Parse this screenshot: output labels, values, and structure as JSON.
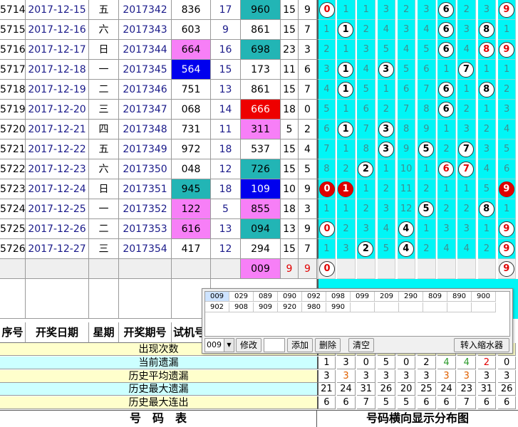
{
  "colors": {
    "accent_cyan": "#00f6f6",
    "teal": "#22b5b5",
    "pink": "#f77ff7",
    "blue": "#0000ee",
    "red": "#ee0000",
    "yellow": "#ffffcc",
    "light_cyan": "#ccffff"
  },
  "rows": [
    {
      "seq": "5714",
      "date": "2017-12-15",
      "week": "五",
      "period": "2017342",
      "trial": "836",
      "trial_bg": "",
      "sum1": "17",
      "draw": "960",
      "draw_bg": "teal",
      "sum2": "15",
      "span": "9",
      "cells": [
        {
          "v": "0",
          "s": "red-text"
        },
        {
          "v": "1",
          "s": ""
        },
        {
          "v": "1",
          "s": ""
        },
        {
          "v": "3",
          "s": ""
        },
        {
          "v": "2",
          "s": ""
        },
        {
          "v": "3",
          "s": ""
        },
        {
          "v": "6",
          "s": "ball"
        },
        {
          "v": "2",
          "s": ""
        },
        {
          "v": "3",
          "s": ""
        },
        {
          "v": "9",
          "s": "red-text"
        }
      ]
    },
    {
      "seq": "5715",
      "date": "2017-12-16",
      "week": "六",
      "period": "2017343",
      "trial": "603",
      "trial_bg": "",
      "sum1": "9",
      "draw": "861",
      "draw_bg": "",
      "sum2": "15",
      "span": "7",
      "cells": [
        {
          "v": "1",
          "s": ""
        },
        {
          "v": "1",
          "s": "ball"
        },
        {
          "v": "2",
          "s": ""
        },
        {
          "v": "4",
          "s": ""
        },
        {
          "v": "3",
          "s": ""
        },
        {
          "v": "4",
          "s": ""
        },
        {
          "v": "6",
          "s": "ball"
        },
        {
          "v": "3",
          "s": ""
        },
        {
          "v": "8",
          "s": "ball"
        },
        {
          "v": "1",
          "s": ""
        }
      ]
    },
    {
      "seq": "5716",
      "date": "2017-12-17",
      "week": "日",
      "period": "2017344",
      "trial": "664",
      "trial_bg": "pink",
      "sum1": "16",
      "draw": "698",
      "draw_bg": "teal",
      "sum2": "23",
      "span": "3",
      "cells": [
        {
          "v": "2",
          "s": ""
        },
        {
          "v": "1",
          "s": ""
        },
        {
          "v": "3",
          "s": ""
        },
        {
          "v": "5",
          "s": ""
        },
        {
          "v": "4",
          "s": ""
        },
        {
          "v": "5",
          "s": ""
        },
        {
          "v": "6",
          "s": "ball"
        },
        {
          "v": "4",
          "s": ""
        },
        {
          "v": "8",
          "s": "red-text"
        },
        {
          "v": "9",
          "s": "red-text"
        }
      ]
    },
    {
      "seq": "5717",
      "date": "2017-12-18",
      "week": "一",
      "period": "2017345",
      "trial": "564",
      "trial_bg": "blue",
      "sum1": "15",
      "draw": "173",
      "draw_bg": "",
      "sum2": "11",
      "span": "6",
      "cells": [
        {
          "v": "3",
          "s": ""
        },
        {
          "v": "1",
          "s": "ball"
        },
        {
          "v": "4",
          "s": ""
        },
        {
          "v": "3",
          "s": "ball"
        },
        {
          "v": "5",
          "s": ""
        },
        {
          "v": "6",
          "s": ""
        },
        {
          "v": "1",
          "s": ""
        },
        {
          "v": "7",
          "s": "ball"
        },
        {
          "v": "1",
          "s": ""
        },
        {
          "v": "1",
          "s": ""
        }
      ]
    },
    {
      "seq": "5718",
      "date": "2017-12-19",
      "week": "二",
      "period": "2017346",
      "trial": "751",
      "trial_bg": "",
      "sum1": "13",
      "draw": "861",
      "draw_bg": "",
      "sum2": "15",
      "span": "7",
      "cells": [
        {
          "v": "4",
          "s": ""
        },
        {
          "v": "1",
          "s": "ball"
        },
        {
          "v": "5",
          "s": ""
        },
        {
          "v": "1",
          "s": ""
        },
        {
          "v": "6",
          "s": ""
        },
        {
          "v": "7",
          "s": ""
        },
        {
          "v": "6",
          "s": "ball"
        },
        {
          "v": "1",
          "s": ""
        },
        {
          "v": "8",
          "s": "ball"
        },
        {
          "v": "2",
          "s": ""
        }
      ]
    },
    {
      "seq": "5719",
      "date": "2017-12-20",
      "week": "三",
      "period": "2017347",
      "trial": "068",
      "trial_bg": "",
      "sum1": "14",
      "draw": "666",
      "draw_bg": "red",
      "sum2": "18",
      "span": "0",
      "cells": [
        {
          "v": "5",
          "s": ""
        },
        {
          "v": "1",
          "s": ""
        },
        {
          "v": "6",
          "s": ""
        },
        {
          "v": "2",
          "s": ""
        },
        {
          "v": "7",
          "s": ""
        },
        {
          "v": "8",
          "s": ""
        },
        {
          "v": "6",
          "s": "ball"
        },
        {
          "v": "2",
          "s": ""
        },
        {
          "v": "1",
          "s": ""
        },
        {
          "v": "3",
          "s": ""
        }
      ]
    },
    {
      "seq": "5720",
      "date": "2017-12-21",
      "week": "四",
      "period": "2017348",
      "trial": "731",
      "trial_bg": "",
      "sum1": "11",
      "draw": "311",
      "draw_bg": "pink",
      "sum2": "5",
      "span": "2",
      "cells": [
        {
          "v": "6",
          "s": ""
        },
        {
          "v": "1",
          "s": "ball"
        },
        {
          "v": "7",
          "s": ""
        },
        {
          "v": "3",
          "s": "ball"
        },
        {
          "v": "8",
          "s": ""
        },
        {
          "v": "9",
          "s": ""
        },
        {
          "v": "1",
          "s": ""
        },
        {
          "v": "3",
          "s": ""
        },
        {
          "v": "2",
          "s": ""
        },
        {
          "v": "4",
          "s": ""
        }
      ]
    },
    {
      "seq": "5721",
      "date": "2017-12-22",
      "week": "五",
      "period": "2017349",
      "trial": "972",
      "trial_bg": "",
      "sum1": "18",
      "draw": "537",
      "draw_bg": "",
      "sum2": "15",
      "span": "4",
      "cells": [
        {
          "v": "7",
          "s": ""
        },
        {
          "v": "1",
          "s": ""
        },
        {
          "v": "8",
          "s": ""
        },
        {
          "v": "3",
          "s": "ball"
        },
        {
          "v": "9",
          "s": ""
        },
        {
          "v": "5",
          "s": "ball"
        },
        {
          "v": "2",
          "s": ""
        },
        {
          "v": "7",
          "s": "ball"
        },
        {
          "v": "3",
          "s": ""
        },
        {
          "v": "5",
          "s": ""
        }
      ]
    },
    {
      "seq": "5722",
      "date": "2017-12-23",
      "week": "六",
      "period": "2017350",
      "trial": "048",
      "trial_bg": "",
      "sum1": "12",
      "draw": "726",
      "draw_bg": "teal",
      "sum2": "15",
      "span": "5",
      "cells": [
        {
          "v": "8",
          "s": ""
        },
        {
          "v": "2",
          "s": ""
        },
        {
          "v": "2",
          "s": "ball"
        },
        {
          "v": "1",
          "s": ""
        },
        {
          "v": "10",
          "s": ""
        },
        {
          "v": "1",
          "s": ""
        },
        {
          "v": "6",
          "s": "red-text"
        },
        {
          "v": "7",
          "s": "red-text"
        },
        {
          "v": "4",
          "s": ""
        },
        {
          "v": "6",
          "s": ""
        }
      ]
    },
    {
      "seq": "5723",
      "date": "2017-12-24",
      "week": "日",
      "period": "2017351",
      "trial": "945",
      "trial_bg": "teal",
      "sum1": "18",
      "draw": "109",
      "draw_bg": "blue",
      "sum2": "10",
      "span": "9",
      "cells": [
        {
          "v": "0",
          "s": "red-ball"
        },
        {
          "v": "1",
          "s": "red-ball"
        },
        {
          "v": "1",
          "s": ""
        },
        {
          "v": "2",
          "s": ""
        },
        {
          "v": "11",
          "s": ""
        },
        {
          "v": "2",
          "s": ""
        },
        {
          "v": "1",
          "s": ""
        },
        {
          "v": "1",
          "s": ""
        },
        {
          "v": "5",
          "s": ""
        },
        {
          "v": "9",
          "s": "red-ball"
        }
      ]
    },
    {
      "seq": "5724",
      "date": "2017-12-25",
      "week": "一",
      "period": "2017352",
      "trial": "122",
      "trial_bg": "pink",
      "sum1": "5",
      "draw": "855",
      "draw_bg": "pink",
      "sum2": "18",
      "span": "3",
      "cells": [
        {
          "v": "1",
          "s": ""
        },
        {
          "v": "1",
          "s": ""
        },
        {
          "v": "2",
          "s": ""
        },
        {
          "v": "3",
          "s": ""
        },
        {
          "v": "12",
          "s": ""
        },
        {
          "v": "5",
          "s": "ball"
        },
        {
          "v": "2",
          "s": ""
        },
        {
          "v": "2",
          "s": ""
        },
        {
          "v": "8",
          "s": "ball"
        },
        {
          "v": "1",
          "s": ""
        }
      ]
    },
    {
      "seq": "5725",
      "date": "2017-12-26",
      "week": "二",
      "period": "2017353",
      "trial": "616",
      "trial_bg": "pink",
      "sum1": "13",
      "draw": "094",
      "draw_bg": "teal",
      "sum2": "13",
      "span": "9",
      "cells": [
        {
          "v": "0",
          "s": "red-text"
        },
        {
          "v": "2",
          "s": ""
        },
        {
          "v": "3",
          "s": ""
        },
        {
          "v": "4",
          "s": ""
        },
        {
          "v": "4",
          "s": "ball"
        },
        {
          "v": "1",
          "s": ""
        },
        {
          "v": "3",
          "s": ""
        },
        {
          "v": "3",
          "s": ""
        },
        {
          "v": "1",
          "s": ""
        },
        {
          "v": "9",
          "s": "red-text"
        }
      ]
    },
    {
      "seq": "5726",
      "date": "2017-12-27",
      "week": "三",
      "period": "2017354",
      "trial": "417",
      "trial_bg": "",
      "sum1": "12",
      "draw": "294",
      "draw_bg": "",
      "sum2": "15",
      "span": "7",
      "cells": [
        {
          "v": "1",
          "s": ""
        },
        {
          "v": "3",
          "s": ""
        },
        {
          "v": "2",
          "s": "ball"
        },
        {
          "v": "5",
          "s": ""
        },
        {
          "v": "4",
          "s": "ball"
        },
        {
          "v": "2",
          "s": ""
        },
        {
          "v": "4",
          "s": ""
        },
        {
          "v": "4",
          "s": ""
        },
        {
          "v": "2",
          "s": ""
        },
        {
          "v": "9",
          "s": "red-text"
        }
      ]
    }
  ],
  "forecast_row": {
    "draw": "009",
    "sum2": "9",
    "span": "9",
    "c0": "0",
    "c9": "9"
  },
  "header": {
    "seq": "序号",
    "date": "开奖日期",
    "week": "星期",
    "period": "开奖期号",
    "trial": "试机号"
  },
  "stats": [
    {
      "label": "出现次数",
      "vals": [
        "",
        "",
        "",
        "",
        "",
        "",
        "",
        "",
        "",
        ""
      ],
      "colors": []
    },
    {
      "label": "当前遗漏",
      "vals": [
        "1",
        "3",
        "0",
        "5",
        "0",
        "2",
        "4",
        "4",
        "2",
        "0"
      ],
      "colors": [
        "#000",
        "#000",
        "#000",
        "#000",
        "#000",
        "#000",
        "#2a9a2a",
        "#2a9a2a",
        "#e00000",
        "#000"
      ]
    },
    {
      "label": "历史平均遗漏",
      "vals": [
        "3",
        "3",
        "3",
        "3",
        "3",
        "3",
        "3",
        "3",
        "3",
        "3"
      ],
      "colors": [
        "#000",
        "#e06000",
        "#000",
        "#000",
        "#000",
        "#000",
        "#e06000",
        "#e06000",
        "#000",
        "#000"
      ]
    },
    {
      "label": "历史最大遗漏",
      "vals": [
        "21",
        "24",
        "31",
        "26",
        "20",
        "25",
        "24",
        "23",
        "31",
        "26"
      ],
      "colors": []
    },
    {
      "label": "历史最大连出",
      "vals": [
        "6",
        "6",
        "7",
        "5",
        "5",
        "6",
        "6",
        "7",
        "6",
        "6"
      ],
      "colors": []
    }
  ],
  "footer": {
    "left": "号　码　表",
    "right": "号码横向显示分布图"
  },
  "dialog": {
    "list_row1": [
      "009",
      "029",
      "089",
      "090",
      "092",
      "098",
      "099",
      "209",
      "290",
      "809",
      "890",
      "900"
    ],
    "list_row2": [
      "902",
      "908",
      "909",
      "920",
      "980",
      "990"
    ],
    "combo_value": "009",
    "input_value": "",
    "btn_modify": "修改",
    "btn_add": "添加",
    "btn_delete": "删除",
    "btn_clear": "清空",
    "btn_shrink": "转入缩水器"
  }
}
